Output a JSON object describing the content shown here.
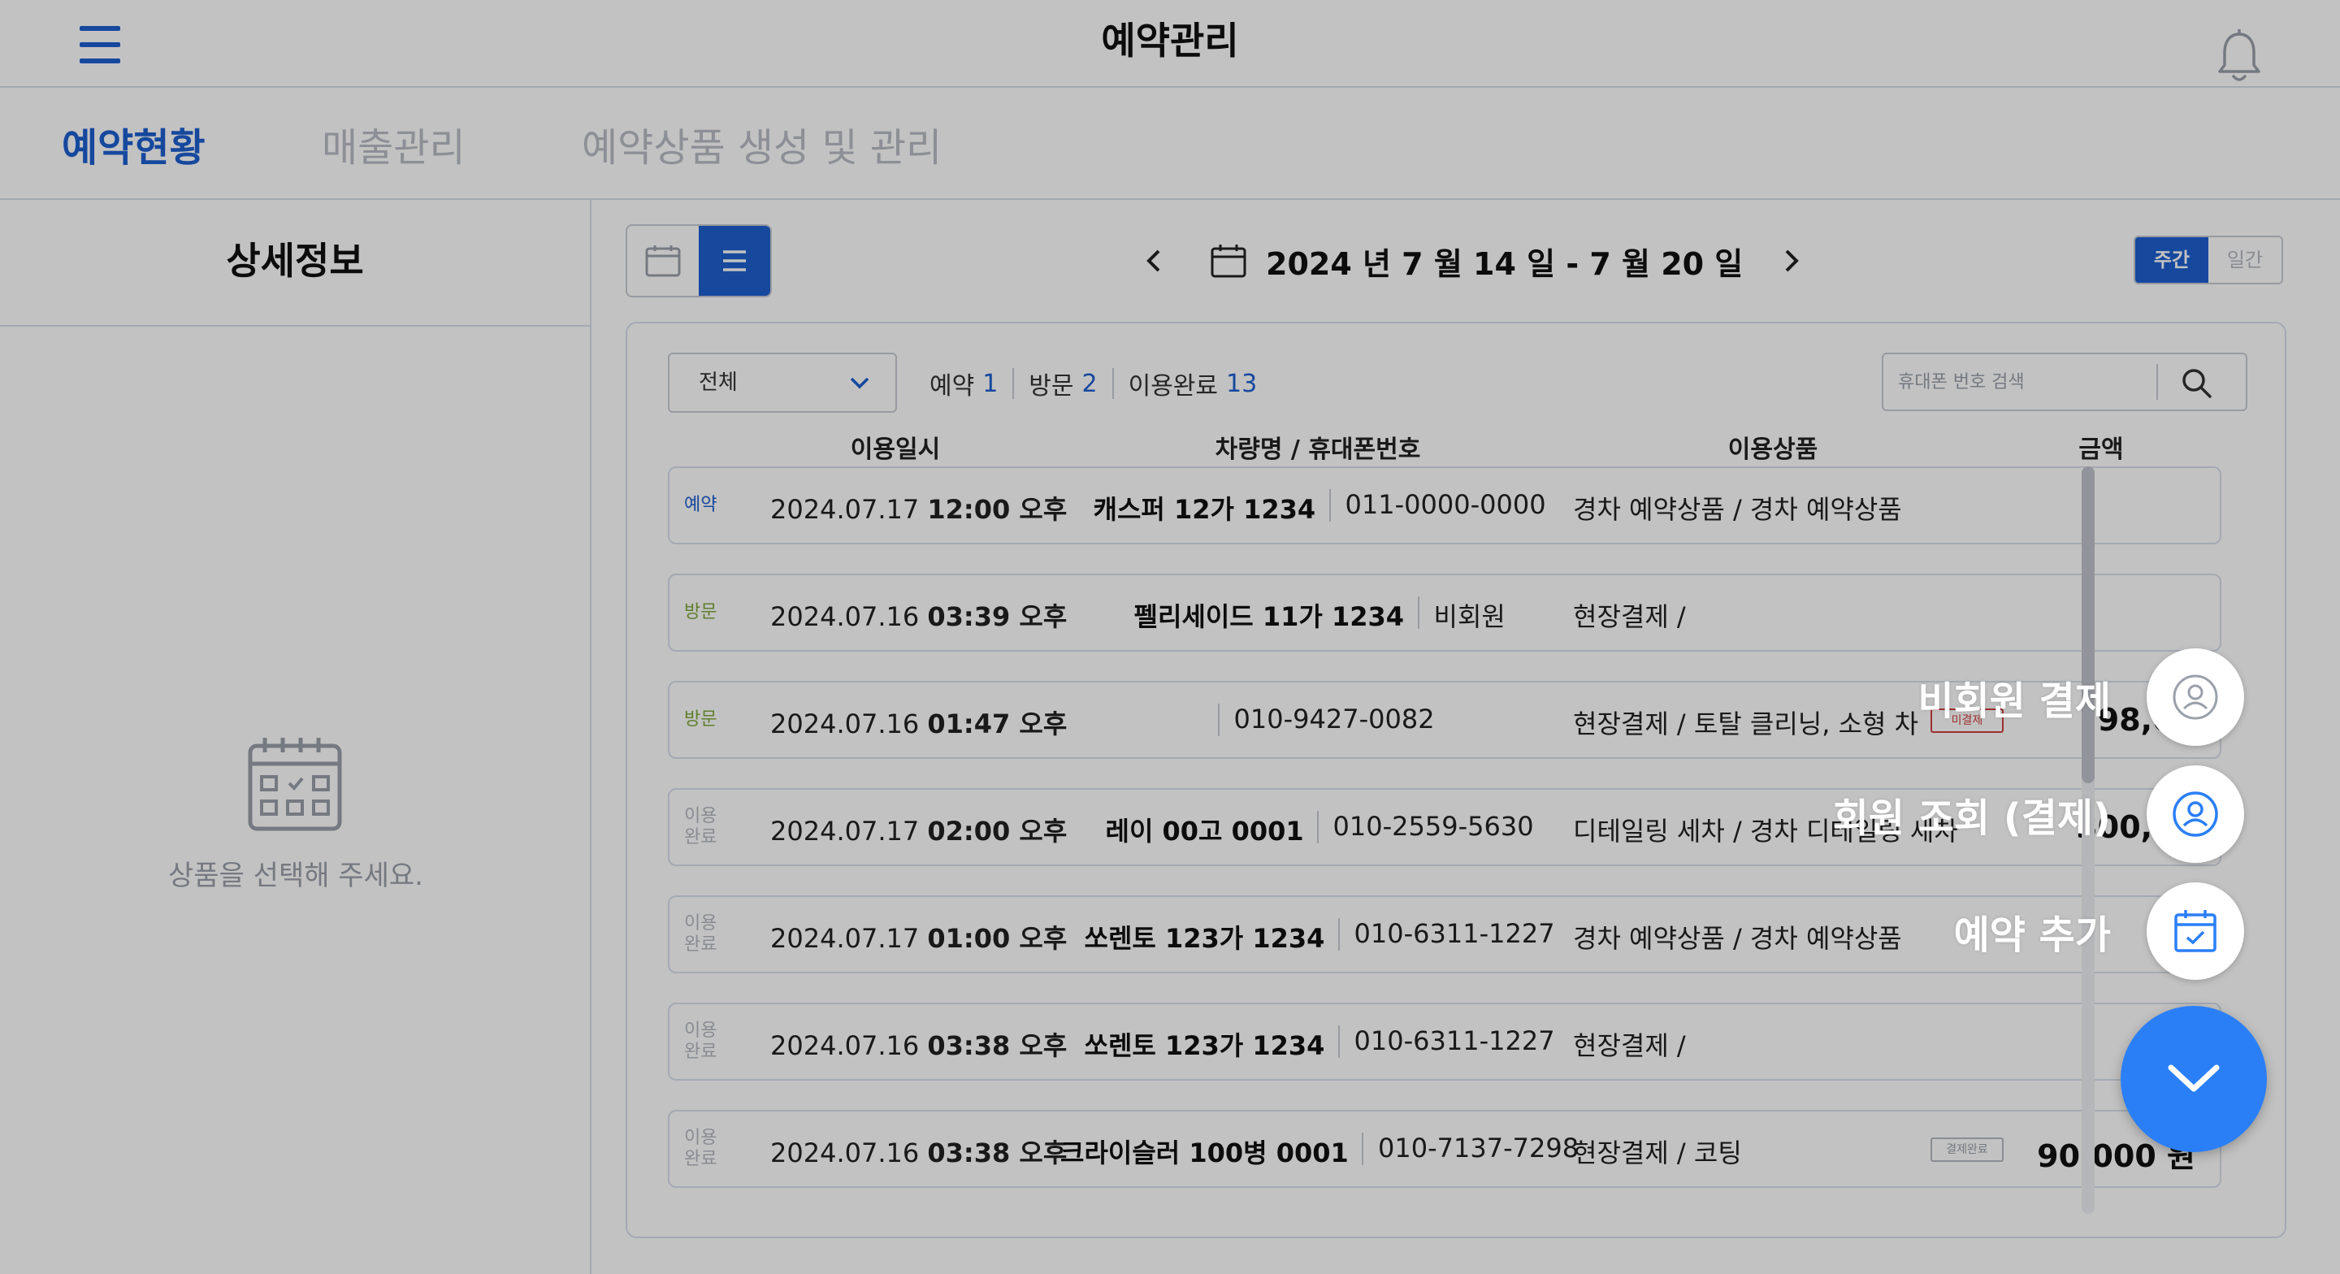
{
  "header": {
    "title": "예약관리"
  },
  "tabs": [
    {
      "label": "예약현황",
      "active": true
    },
    {
      "label": "매출관리",
      "active": false
    },
    {
      "label": "예약상품 생성 및 관리",
      "active": false
    }
  ],
  "left_panel": {
    "title": "상세정보",
    "empty_text": "상품을 선택해 주세요."
  },
  "toolbar": {
    "date_range": "2024 년 7 월 14 일 - 7 월 20 일",
    "period_week": "주간",
    "period_day": "일간",
    "active_view": "list"
  },
  "filter": {
    "selected": "전체"
  },
  "counts": [
    {
      "label": "예약",
      "value": "1"
    },
    {
      "label": "방문",
      "value": "2"
    },
    {
      "label": "이용완료",
      "value": "13"
    }
  ],
  "search": {
    "placeholder": "휴대폰 번호 검색",
    "value": ""
  },
  "columns": {
    "datetime": "이용일시",
    "vehicle": "차량명 / 휴대폰번호",
    "product": "이용상품",
    "amount": "금액"
  },
  "rows": [
    {
      "status_1": "예약",
      "status_2": "",
      "status_type": "reserve",
      "date": "2024.07.17",
      "time": "12:00 오후",
      "vehicle": "캐스퍼 12가 1234",
      "phone": "011-0000-0000",
      "product": "경차 예약상품 / 경차 예약상품",
      "badge": "",
      "amount": ""
    },
    {
      "status_1": "방문",
      "status_2": "",
      "status_type": "visit",
      "date": "2024.07.16",
      "time": "03:39 오후",
      "vehicle": "펠리세이드 11가 1234",
      "phone": "비회원",
      "product": "현장결제 /",
      "badge": "",
      "amount": ""
    },
    {
      "status_1": "방문",
      "status_2": "",
      "status_type": "visit",
      "date": "2024.07.16",
      "time": "01:47 오후",
      "vehicle": "",
      "phone": "010-9427-0082",
      "product": "현장결제 / 토탈 클리닝, 소형 차",
      "badge": "미결제",
      "amount": "98,00"
    },
    {
      "status_1": "이용",
      "status_2": "완료",
      "status_type": "done",
      "date": "2024.07.17",
      "time": "02:00 오후",
      "vehicle": "레이 00고 0001",
      "phone": "010-2559-5630",
      "product": "디테일링 세차 / 경차 디테일링 세차",
      "badge": "",
      "amount": "300,00"
    },
    {
      "status_1": "이용",
      "status_2": "완료",
      "status_type": "done",
      "date": "2024.07.17",
      "time": "01:00 오후",
      "vehicle": "쏘렌토 123가 1234",
      "phone": "010-6311-1227",
      "product": "경차 예약상품 / 경차 예약상품",
      "badge": "",
      "amount": ""
    },
    {
      "status_1": "이용",
      "status_2": "완료",
      "status_type": "done",
      "date": "2024.07.16",
      "time": "03:38 오후",
      "vehicle": "쏘렌토 123가 1234",
      "phone": "010-6311-1227",
      "product": "현장결제 /",
      "badge": "",
      "amount": ""
    },
    {
      "status_1": "이용",
      "status_2": "완료",
      "status_type": "done",
      "date": "2024.07.16",
      "time": "03:38 오후",
      "vehicle": "크라이슬러 100병 0001",
      "phone": "010-7137-7298",
      "product": "현장결제 / 코팅",
      "badge": "결제완료",
      "amount": "90,000 원"
    }
  ],
  "fab_menu": [
    {
      "label": "비회원 결제",
      "icon": "user-outline-icon"
    },
    {
      "label": "회원 조회 (결제)",
      "icon": "user-circle-icon"
    },
    {
      "label": "예약 추가",
      "icon": "calendar-check-icon"
    }
  ],
  "colors": {
    "accent": "#1e5fd0",
    "fab": "#2b7ff6",
    "visit": "#7fa83a",
    "unpaid": "#d04040"
  }
}
